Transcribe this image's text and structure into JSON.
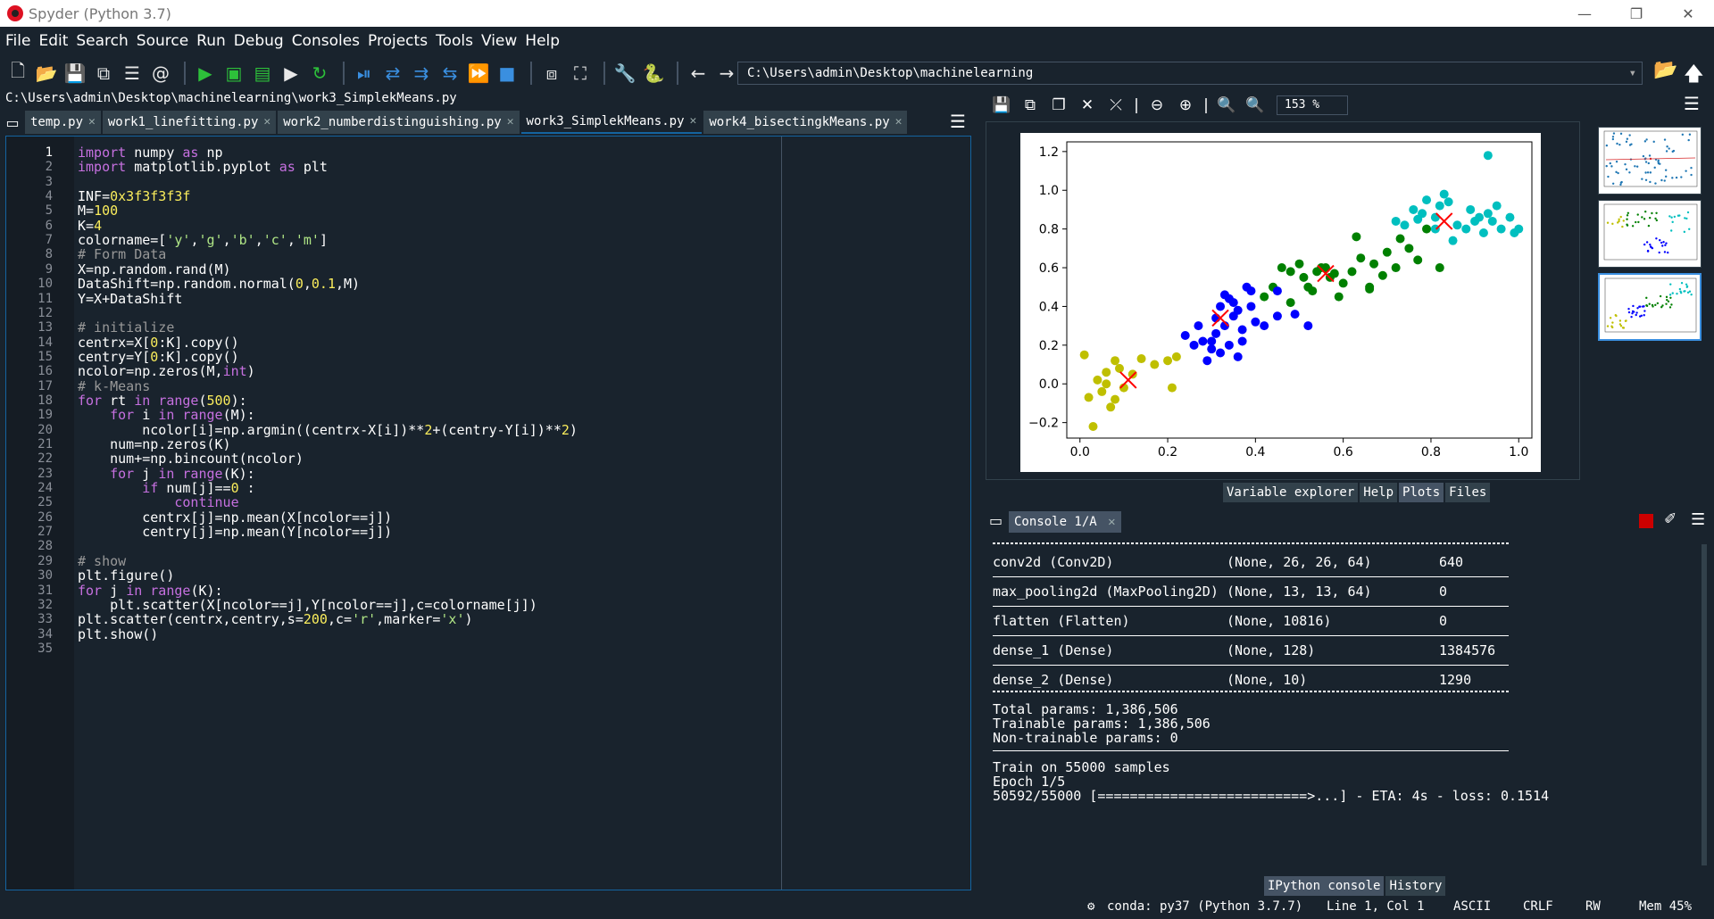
{
  "window": {
    "title": "Spyder (Python 3.7)",
    "minimize": "—",
    "restore": "❐",
    "close": "✕"
  },
  "menu": [
    "File",
    "Edit",
    "Search",
    "Source",
    "Run",
    "Debug",
    "Consoles",
    "Projects",
    "Tools",
    "View",
    "Help"
  ],
  "toolbar": {
    "working_dir": "C:\\Users\\admin\\Desktop\\machinelearning"
  },
  "editor": {
    "file_path": "C:\\Users\\admin\\Desktop\\machinelearning\\work3_SimplekMeans.py",
    "tabs": [
      "temp.py",
      "work1_linefitting.py",
      "work2_numberdistinguishing.py",
      "work3_SimplekMeans.py",
      "work4_bisectingkMeans.py"
    ],
    "active_tab": "work3_SimplekMeans.py",
    "current_line": 1,
    "lines": [
      "import numpy as np",
      "import matplotlib.pyplot as plt",
      "",
      "INF=0x3f3f3f3f",
      "M=100",
      "K=4",
      "colorname=['y','g','b','c','m']",
      "# Form Data",
      "X=np.random.rand(M)",
      "DataShift=np.random.normal(0,0.1,M)",
      "Y=X+DataShift",
      "",
      "# initialize",
      "centrx=X[0:K].copy()",
      "centry=Y[0:K].copy()",
      "ncolor=np.zeros(M,int)",
      "# k-Means",
      "for rt in range(500):",
      "    for i in range(M):",
      "        ncolor[i]=np.argmin((centrx-X[i])**2+(centry-Y[i])**2)",
      "    num=np.zeros(K)",
      "    num+=np.bincount(ncolor)",
      "    for j in range(K):",
      "        if num[j]==0 :",
      "            continue",
      "        centrx[j]=np.mean(X[ncolor==j])",
      "        centry[j]=np.mean(Y[ncolor==j])",
      "",
      "# show",
      "plt.figure()",
      "for j in range(K):",
      "    plt.scatter(X[ncolor==j],Y[ncolor==j],c=colorname[j])",
      "plt.scatter(centrx,centry,s=200,c='r',marker='x')",
      "plt.show()",
      ""
    ]
  },
  "plots": {
    "zoom": "153 %",
    "pane_tabs": [
      "Variable explorer",
      "Help",
      "Plots",
      "Files"
    ],
    "active_pane": "Plots"
  },
  "chart_data": {
    "type": "scatter",
    "title": "",
    "xlabel": "",
    "ylabel": "",
    "xlim": [
      -0.03,
      1.03
    ],
    "ylim": [
      -0.28,
      1.25
    ],
    "x_ticks": [
      "0.0",
      "0.2",
      "0.4",
      "0.6",
      "0.8",
      "1.0"
    ],
    "y_ticks": [
      "−0.2",
      "0.0",
      "0.2",
      "0.4",
      "0.6",
      "0.8",
      "1.0",
      "1.2"
    ],
    "series": [
      {
        "color": "#bfbf00",
        "points": [
          [
            0.01,
            0.15
          ],
          [
            0.02,
            -0.07
          ],
          [
            0.03,
            -0.22
          ],
          [
            0.04,
            0.02
          ],
          [
            0.05,
            -0.04
          ],
          [
            0.06,
            0.0
          ],
          [
            0.07,
            -0.12
          ],
          [
            0.08,
            0.12
          ],
          [
            0.09,
            0.08
          ],
          [
            0.1,
            -0.02
          ],
          [
            0.12,
            0.05
          ],
          [
            0.14,
            0.13
          ],
          [
            0.17,
            0.1
          ],
          [
            0.2,
            0.12
          ],
          [
            0.21,
            -0.02
          ],
          [
            0.22,
            0.14
          ],
          [
            0.06,
            0.06
          ],
          [
            0.08,
            -0.08
          ]
        ]
      },
      {
        "color": "#008000",
        "points": [
          [
            0.42,
            0.45
          ],
          [
            0.44,
            0.5
          ],
          [
            0.46,
            0.6
          ],
          [
            0.48,
            0.58
          ],
          [
            0.5,
            0.62
          ],
          [
            0.51,
            0.55
          ],
          [
            0.52,
            0.5
          ],
          [
            0.53,
            0.48
          ],
          [
            0.55,
            0.6
          ],
          [
            0.57,
            0.55
          ],
          [
            0.59,
            0.45
          ],
          [
            0.6,
            0.52
          ],
          [
            0.62,
            0.58
          ],
          [
            0.64,
            0.65
          ],
          [
            0.66,
            0.5
          ],
          [
            0.67,
            0.62
          ],
          [
            0.69,
            0.56
          ],
          [
            0.7,
            0.68
          ],
          [
            0.72,
            0.6
          ],
          [
            0.73,
            0.75
          ],
          [
            0.75,
            0.7
          ],
          [
            0.77,
            0.64
          ],
          [
            0.79,
            0.8
          ],
          [
            0.82,
            0.6
          ],
          [
            0.63,
            0.76
          ],
          [
            0.56,
            0.6
          ],
          [
            0.48,
            0.42
          ],
          [
            0.54,
            0.58
          ],
          [
            0.66,
            0.49
          ],
          [
            0.58,
            0.57
          ]
        ]
      },
      {
        "color": "#0000ff",
        "points": [
          [
            0.24,
            0.25
          ],
          [
            0.26,
            0.2
          ],
          [
            0.27,
            0.3
          ],
          [
            0.28,
            0.22
          ],
          [
            0.29,
            0.12
          ],
          [
            0.3,
            0.18
          ],
          [
            0.31,
            0.26
          ],
          [
            0.32,
            0.4
          ],
          [
            0.33,
            0.3
          ],
          [
            0.34,
            0.44
          ],
          [
            0.35,
            0.35
          ],
          [
            0.36,
            0.14
          ],
          [
            0.37,
            0.28
          ],
          [
            0.38,
            0.5
          ],
          [
            0.39,
            0.4
          ],
          [
            0.4,
            0.32
          ],
          [
            0.33,
            0.46
          ],
          [
            0.35,
            0.42
          ],
          [
            0.36,
            0.38
          ],
          [
            0.34,
            0.2
          ],
          [
            0.32,
            0.16
          ],
          [
            0.39,
            0.48
          ],
          [
            0.45,
            0.48
          ],
          [
            0.49,
            0.36
          ],
          [
            0.52,
            0.3
          ],
          [
            0.45,
            0.35
          ],
          [
            0.42,
            0.3
          ],
          [
            0.37,
            0.22
          ],
          [
            0.31,
            0.34
          ],
          [
            0.3,
            0.22
          ]
        ]
      },
      {
        "color": "#00bfbf",
        "points": [
          [
            0.72,
            0.84
          ],
          [
            0.74,
            0.82
          ],
          [
            0.76,
            0.9
          ],
          [
            0.78,
            0.88
          ],
          [
            0.79,
            0.95
          ],
          [
            0.81,
            0.86
          ],
          [
            0.82,
            0.92
          ],
          [
            0.83,
            0.98
          ],
          [
            0.84,
            0.94
          ],
          [
            0.86,
            0.82
          ],
          [
            0.88,
            0.8
          ],
          [
            0.89,
            0.9
          ],
          [
            0.9,
            0.84
          ],
          [
            0.92,
            0.78
          ],
          [
            0.93,
            0.88
          ],
          [
            0.94,
            0.84
          ],
          [
            0.95,
            0.92
          ],
          [
            0.96,
            0.8
          ],
          [
            0.98,
            0.86
          ],
          [
            1.0,
            0.8
          ],
          [
            0.93,
            1.18
          ],
          [
            0.81,
            0.8
          ],
          [
            0.77,
            0.85
          ],
          [
            0.85,
            0.74
          ],
          [
            0.91,
            0.86
          ],
          [
            0.99,
            0.78
          ]
        ]
      }
    ],
    "centroids": {
      "color": "#ff0000",
      "marker": "x",
      "points": [
        [
          0.11,
          0.02
        ],
        [
          0.32,
          0.34
        ],
        [
          0.56,
          0.57
        ],
        [
          0.83,
          0.84
        ]
      ]
    }
  },
  "console": {
    "tab": "Console 1/A",
    "rows": [
      {
        "name": "conv2d (Conv2D)",
        "shape": "(None, 26, 26, 64)",
        "params": "640"
      },
      {
        "name": "max_pooling2d (MaxPooling2D)",
        "shape": "(None, 13, 13, 64)",
        "params": "0"
      },
      {
        "name": "flatten (Flatten)",
        "shape": "(None, 10816)",
        "params": "0"
      },
      {
        "name": "dense_1 (Dense)",
        "shape": "(None, 128)",
        "params": "1384576"
      },
      {
        "name": "dense_2 (Dense)",
        "shape": "(None, 10)",
        "params": "1290"
      }
    ],
    "total": "Total params: 1,386,506",
    "trainable": "Trainable params: 1,386,506",
    "non_trainable": "Non-trainable params: 0",
    "train_on": "Train on 55000 samples",
    "epoch": "Epoch 1/5",
    "progress": "50592/55000 [==========================>...] - ETA: 4s - loss: 0.1514",
    "bottom_tabs": [
      "IPython console",
      "History"
    ],
    "active_bottom": "IPython console"
  },
  "status": {
    "conda": "conda: py37 (Python 3.7.7)",
    "position": "Line 1, Col 1",
    "encoding": "ASCII",
    "eol": "CRLF",
    "mode": "RW",
    "mem": "Mem 45%"
  }
}
